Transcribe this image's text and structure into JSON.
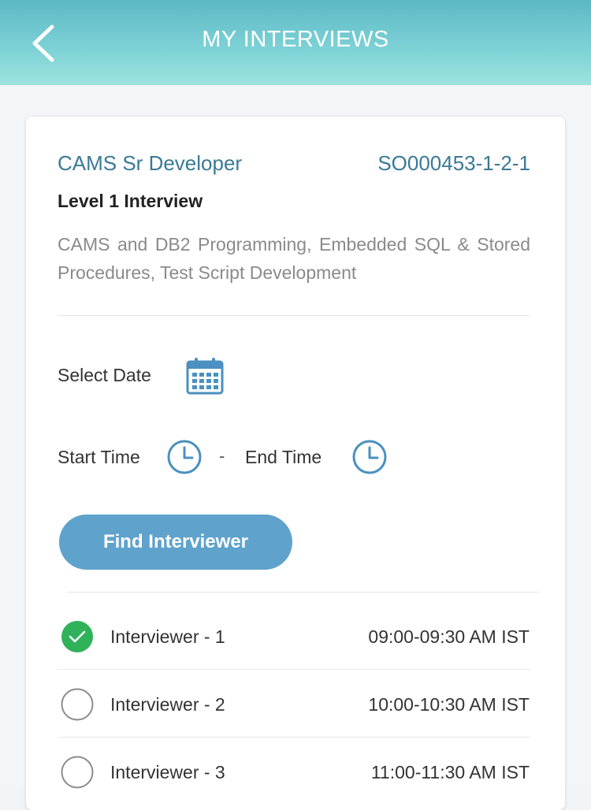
{
  "header": {
    "title": "MY INTERVIEWS",
    "back_icon": "chevron-left-icon",
    "gradient_colors": [
      "#5cb8c5",
      "#9de3df"
    ]
  },
  "job": {
    "title": "CAMS Sr Developer",
    "id": "SO000453-1-2-1",
    "level": "Level 1 Interview",
    "skills": "CAMS and DB2 Programming, Embedded SQL & Stored Procedures, Test Script Development"
  },
  "schedule": {
    "select_date_label": "Select Date",
    "calendar_icon": "calendar-icon",
    "start_time_label": "Start Time",
    "separator": "-",
    "end_time_label": "End Time",
    "clock_icon": "clock-icon"
  },
  "find_button": {
    "label": "Find Interviewer",
    "color": "#5fa2cc"
  },
  "interviewers": [
    {
      "name": "Interviewer - 1",
      "time": "09:00-09:30 AM IST",
      "selected": true
    },
    {
      "name": "Interviewer - 2",
      "time": "10:00-10:30 AM IST",
      "selected": false
    },
    {
      "name": "Interviewer - 3",
      "time": "11:00-11:30 AM IST",
      "selected": false
    }
  ],
  "colors": {
    "accent_text": "#3a7996",
    "selected_check": "#2fb25a",
    "icon_blue": "#4a90c0"
  }
}
